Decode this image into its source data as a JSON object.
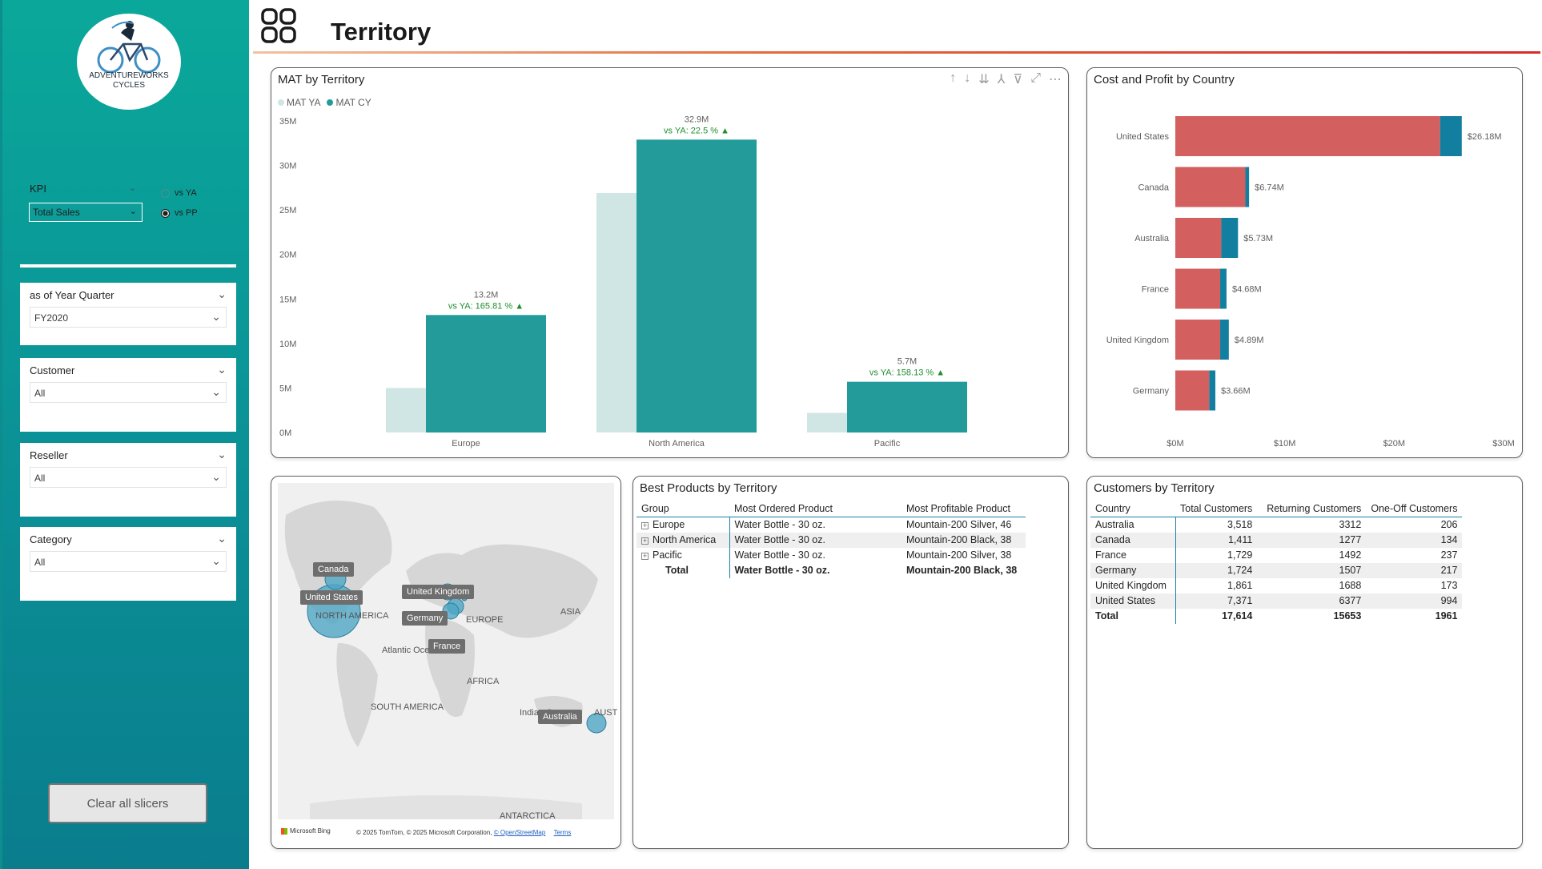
{
  "page": {
    "title": "Territory"
  },
  "logo": {
    "line1": "ADVENTUREWORKS",
    "line2": "CYCLES"
  },
  "sidebar": {
    "kpi_label": "KPI",
    "kpi_value": "Total Sales",
    "radio_options": [
      {
        "label": "vs YA",
        "selected": false
      },
      {
        "label": "vs PP",
        "selected": true
      }
    ],
    "slicers": [
      {
        "title": "as of Year Quarter",
        "value": "FY2020"
      },
      {
        "title": "Customer",
        "value": "All"
      },
      {
        "title": "Reseller",
        "value": "All"
      },
      {
        "title": "Category",
        "value": "All"
      }
    ],
    "clear_button": "Clear all slicers"
  },
  "mat_chart": {
    "title": "MAT by Territory",
    "legend": [
      {
        "label": "MAT YA",
        "color": "#d0e6e4"
      },
      {
        "label": "MAT CY",
        "color": "#249b9b"
      }
    ],
    "chart_data": {
      "type": "bar",
      "categories": [
        "Europe",
        "North America",
        "Pacific"
      ],
      "series": [
        {
          "name": "MAT YA",
          "values": [
            5.0,
            26.9,
            2.2
          ]
        },
        {
          "name": "MAT CY",
          "values": [
            13.2,
            32.9,
            5.7
          ]
        }
      ],
      "data_labels": [
        "13.2M",
        "32.9M",
        "5.7M"
      ],
      "vs_labels": [
        "vs YA: 165.81 %",
        "vs YA: 22.5 %",
        "vs YA: 158.13 %"
      ],
      "ylim": [
        0,
        35
      ],
      "y_ticks": [
        "0M",
        "5M",
        "10M",
        "15M",
        "20M",
        "25M",
        "30M",
        "35M"
      ],
      "y_tick_values": [
        0,
        5,
        10,
        15,
        20,
        25,
        30,
        35
      ]
    }
  },
  "cost_chart": {
    "title": "Cost and Profit by Country",
    "chart_data": {
      "type": "bar",
      "orientation": "horizontal-stacked",
      "categories": [
        "United States",
        "Canada",
        "Australia",
        "France",
        "United Kingdom",
        "Germany"
      ],
      "series": [
        {
          "name": "Cost",
          "color": "#d35f5f",
          "values": [
            24.2,
            6.4,
            4.2,
            4.1,
            4.1,
            3.1
          ]
        },
        {
          "name": "Profit",
          "color": "#137fa0",
          "values": [
            1.98,
            0.34,
            1.53,
            0.58,
            0.79,
            0.56
          ]
        }
      ],
      "total_labels": [
        "$26.18M",
        "$6.74M",
        "$5.73M",
        "$4.68M",
        "$4.89M",
        "$3.66M"
      ],
      "xlim": [
        0,
        30
      ],
      "x_ticks": [
        "$0M",
        "$10M",
        "$20M",
        "$30M"
      ],
      "x_tick_values": [
        0,
        10,
        20,
        30
      ]
    }
  },
  "map": {
    "labels": {
      "north_america": "NORTH AMERICA",
      "europe": "EUROPE",
      "asia": "ASIA",
      "atlantic": "Atlantic Oce",
      "africa": "AFRICA",
      "south_america": "SOUTH AMERICA",
      "indian": "Indian Ocean",
      "aust": "AUST",
      "antarctica": "ANTARCTICA"
    },
    "pills": {
      "canada": "Canada",
      "united_states": "United States",
      "united_kingdom": "United Kingdom",
      "germany": "Germany",
      "france": "France",
      "australia": "Australia"
    },
    "attribution": "© 2025 TomTom, © 2025 Microsoft Corporation,",
    "osm": "© OpenStreetMap",
    "terms": "Terms",
    "bing": "Microsoft Bing",
    "bubble_color": "#4ea6c4"
  },
  "best_products": {
    "title": "Best Products by Territory",
    "headers": [
      "Group",
      "Most Ordered Product",
      "Most Profitable Product"
    ],
    "rows": [
      {
        "group": "Europe",
        "ordered": "Water Bottle - 30 oz.",
        "profitable": "Mountain-200 Silver, 46"
      },
      {
        "group": "North America",
        "ordered": "Water Bottle - 30 oz.",
        "profitable": "Mountain-200 Black, 38"
      },
      {
        "group": "Pacific",
        "ordered": "Water Bottle - 30 oz.",
        "profitable": "Mountain-200 Silver, 38"
      }
    ],
    "total": {
      "group": "Total",
      "ordered": "Water Bottle - 30 oz.",
      "profitable": "Mountain-200 Black, 38"
    }
  },
  "customers": {
    "title": "Customers by Territory",
    "headers": [
      "Country",
      "Total Customers",
      "Returning Customers",
      "One-Off Customers"
    ],
    "rows": [
      {
        "country": "Australia",
        "total": "3,518",
        "returning": "3312",
        "oneoff": "206"
      },
      {
        "country": "Canada",
        "total": "1,411",
        "returning": "1277",
        "oneoff": "134"
      },
      {
        "country": "France",
        "total": "1,729",
        "returning": "1492",
        "oneoff": "237"
      },
      {
        "country": "Germany",
        "total": "1,724",
        "returning": "1507",
        "oneoff": "217"
      },
      {
        "country": "United Kingdom",
        "total": "1,861",
        "returning": "1688",
        "oneoff": "173"
      },
      {
        "country": "United States",
        "total": "7,371",
        "returning": "6377",
        "oneoff": "994"
      }
    ],
    "total": {
      "country": "Total",
      "total": "17,614",
      "returning": "15653",
      "oneoff": "1961"
    }
  }
}
